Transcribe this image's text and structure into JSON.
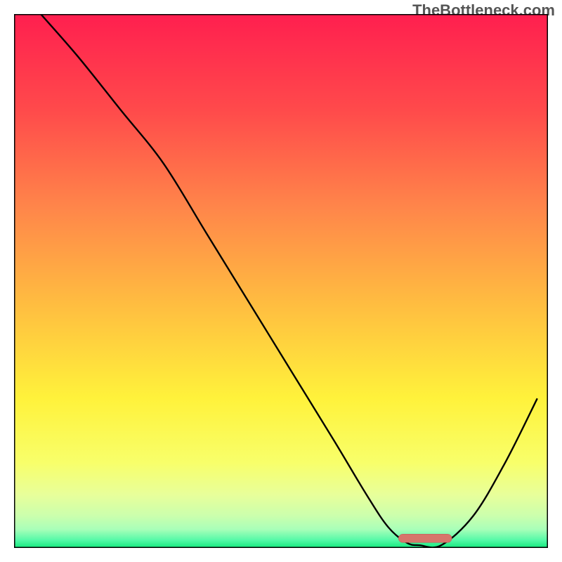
{
  "watermark": "TheBottleneck.com",
  "chart_data": {
    "type": "line",
    "title": "",
    "xlabel": "",
    "ylabel": "",
    "xlim": [
      0,
      100
    ],
    "ylim": [
      0,
      100
    ],
    "series": [
      {
        "name": "curve",
        "x": [
          5,
          12,
          20,
          28,
          36,
          44,
          52,
          60,
          66,
          70,
          73.5,
          76,
          80,
          86,
          92,
          98
        ],
        "y": [
          100,
          92,
          82,
          72,
          59,
          46,
          33,
          20,
          10,
          4,
          1,
          0.5,
          0.5,
          6,
          16,
          28
        ]
      }
    ],
    "marker": {
      "name": "pill",
      "x_start": 72,
      "x_end": 82,
      "y": 1.8,
      "color": "#d7756b"
    },
    "background_gradient": {
      "stops": [
        {
          "offset": 0.0,
          "color": "#ff1f4f"
        },
        {
          "offset": 0.18,
          "color": "#ff4a4b"
        },
        {
          "offset": 0.36,
          "color": "#ff854a"
        },
        {
          "offset": 0.55,
          "color": "#ffbf40"
        },
        {
          "offset": 0.72,
          "color": "#fff23b"
        },
        {
          "offset": 0.84,
          "color": "#f8ff6a"
        },
        {
          "offset": 0.9,
          "color": "#e8ff9a"
        },
        {
          "offset": 0.94,
          "color": "#cbffad"
        },
        {
          "offset": 0.965,
          "color": "#a9ffb9"
        },
        {
          "offset": 0.985,
          "color": "#56f9a8"
        },
        {
          "offset": 1.0,
          "color": "#12e97c"
        }
      ]
    }
  }
}
